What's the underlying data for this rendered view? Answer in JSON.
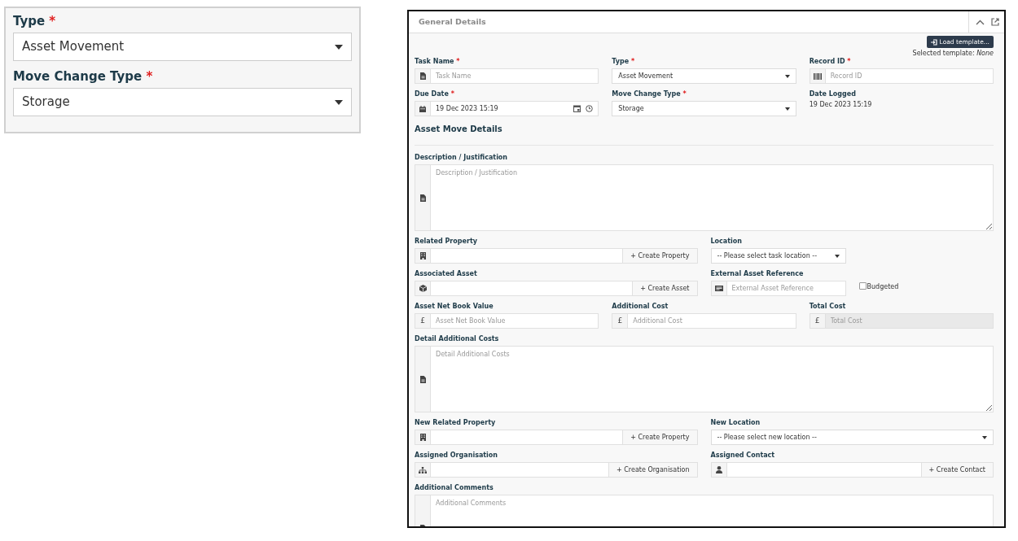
{
  "inset": {
    "fields": [
      {
        "label": "Type",
        "required_mark": "*",
        "value": "Asset Movement"
      },
      {
        "label": "Move Change Type",
        "required_mark": "*",
        "value": "Storage"
      }
    ]
  },
  "panel": {
    "title": "General Details",
    "load_button": "Load template...",
    "selected_template": "Selected template: *None*",
    "rows": [
      {
        "kind": "fields",
        "fields": [
          {
            "kind": "input",
            "label": "Task Name",
            "required_mark": "*",
            "placeholder": "Task Name"
          },
          {
            "kind": "select",
            "label": "Type",
            "required_mark": "*",
            "value": "Asset Movement"
          },
          {
            "kind": "input",
            "label": "Record ID",
            "required_mark": "*",
            "placeholder": "Record ID"
          }
        ]
      },
      {
        "kind": "fields",
        "fields": [
          {
            "kind": "datetime",
            "label": "Due Date",
            "required_mark": "*",
            "value": "19 Dec 2023 15:19"
          },
          {
            "kind": "select",
            "label": "Move Change Type",
            "required_mark": "*",
            "value": "Storage"
          },
          {
            "kind": "static",
            "label": "Date Logged",
            "value": "19 Dec 2023 15:19"
          }
        ]
      },
      {
        "kind": "heading",
        "text": "Asset Move Details"
      },
      {
        "kind": "fields",
        "fields": [
          {
            "kind": "textarea",
            "label": "Description / Justification",
            "placeholder": "Description / Justification"
          }
        ]
      },
      {
        "kind": "fields",
        "fields": [
          {
            "kind": "lookup",
            "label": "Related Property",
            "button": "+ Create Property"
          },
          {
            "kind": "select",
            "label": "Location",
            "value": "-- Please select task location --",
            "compact": true
          }
        ]
      },
      {
        "kind": "fields",
        "fields": [
          {
            "kind": "lookup",
            "label": "Associated Asset",
            "button": "+ Create Asset"
          },
          {
            "kind": "input",
            "label": "External Asset Reference",
            "placeholder": "External Asset Reference",
            "checkbox": {
              "label": "Budgeted",
              "checked": false
            }
          }
        ]
      },
      {
        "kind": "fields",
        "fields": [
          {
            "kind": "input",
            "label": "Asset Net Book Value",
            "addon": "£",
            "placeholder": "Asset Net Book Value"
          },
          {
            "kind": "input",
            "label": "Additional Cost",
            "addon": "£",
            "placeholder": "Additional Cost"
          },
          {
            "kind": "input",
            "label": "Total Cost",
            "addon": "£",
            "placeholder": "Total Cost",
            "disabled": true
          }
        ]
      },
      {
        "kind": "fields",
        "fields": [
          {
            "kind": "textarea",
            "label": "Detail Additional Costs",
            "placeholder": "Detail Additional Costs"
          }
        ]
      },
      {
        "kind": "fields",
        "fields": [
          {
            "kind": "lookup",
            "label": "New Related Property",
            "button": "+ Create Property"
          },
          {
            "kind": "select",
            "label": "New Location",
            "value": "-- Please select new location --"
          }
        ]
      },
      {
        "kind": "fields",
        "fields": [
          {
            "kind": "lookup",
            "label": "Assigned Organisation",
            "button": "+ Create Organisation"
          },
          {
            "kind": "lookup",
            "label": "Assigned Contact",
            "button": "+ Create Contact"
          }
        ]
      },
      {
        "kind": "fields",
        "fields": [
          {
            "kind": "textarea",
            "label": "Additional Comments",
            "placeholder": "Additional Comments"
          }
        ]
      }
    ]
  }
}
